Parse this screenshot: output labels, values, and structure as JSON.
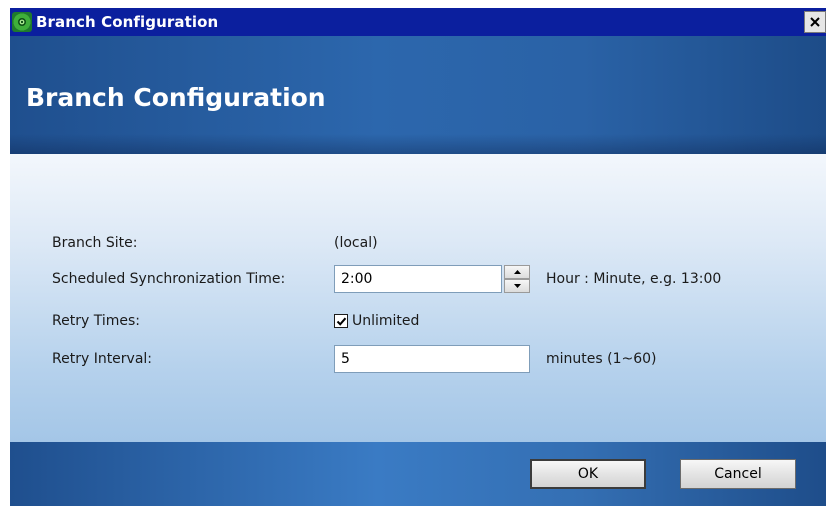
{
  "window": {
    "title": "Branch Configuration",
    "icon": "app-gear-icon",
    "close_glyph": "close-icon"
  },
  "header": {
    "title": "Branch Configuration"
  },
  "form": {
    "branch_site": {
      "label": "Branch Site:",
      "value": "(local)"
    },
    "sync_time": {
      "label": "Scheduled Synchronization Time:",
      "value": "2:00",
      "hint": "Hour : Minute, e.g. 13:00"
    },
    "retry_times": {
      "label": "Retry Times:",
      "checkbox_label": "Unlimited",
      "checked": true
    },
    "retry_interval": {
      "label": "Retry Interval:",
      "value": "5",
      "hint": "minutes (1~60)"
    }
  },
  "footer": {
    "ok_label": "OK",
    "cancel_label": "Cancel"
  },
  "colors": {
    "titlebar": "#0b1f9e",
    "header": "#2c67ad",
    "content_top": "#f3f7fc",
    "content_bottom": "#a4c6e7"
  }
}
